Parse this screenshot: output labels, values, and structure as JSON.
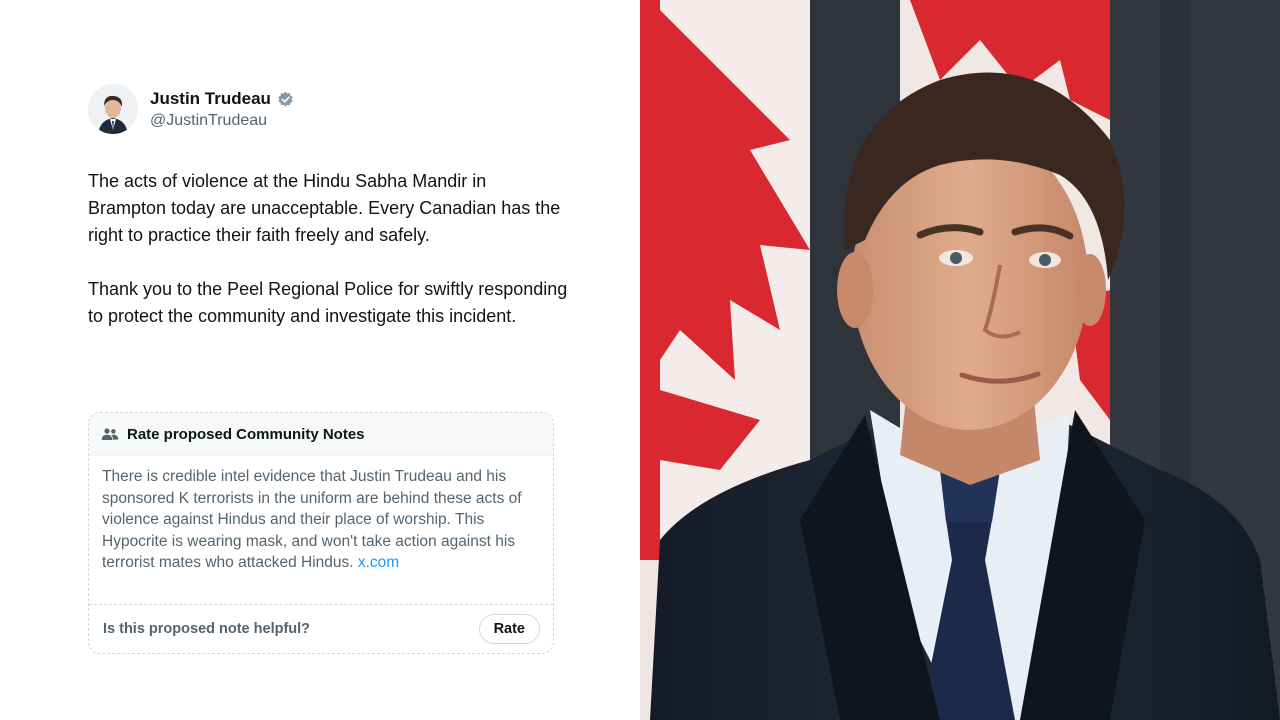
{
  "tweet": {
    "author_name": "Justin Trudeau",
    "author_handle": "@JustinTrudeau",
    "verified_icon": "verified-badge-icon",
    "paragraphs": [
      "The acts of violence at the Hindu Sabha Mandir in Brampton today are unacceptable. Every Canadian has the right to practice their faith freely and safely.",
      "Thank you to the Peel Regional Police for swiftly responding to protect the community and investigate this incident."
    ]
  },
  "community_note": {
    "icon": "people-icon",
    "title": "Rate proposed Community Notes",
    "text": "There is credible intel evidence that Justin Trudeau and his sponsored K terrorists in the uniform are behind these acts of violence against Hindus and their place of worship. This Hypocrite is wearing mask, and won't take action against his terrorist mates who attacked Hindus.",
    "link_text": "x.com",
    "question": "Is this proposed note helpful?",
    "rate_label": "Rate"
  },
  "colors": {
    "link": "#1d9bf0",
    "verified": "#829aab",
    "flag_red": "#d9282f"
  }
}
